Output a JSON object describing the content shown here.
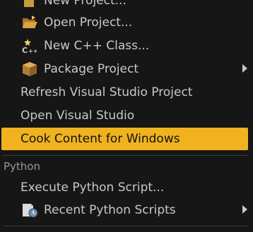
{
  "menu": {
    "items": [
      {
        "label": "New Project...",
        "icon": "new-project-icon"
      },
      {
        "label": "Open Project...",
        "icon": "open-project-icon"
      },
      {
        "label": "New C++ Class...",
        "icon": "new-cpp-class-icon"
      },
      {
        "label": "Package Project",
        "icon": "package-icon",
        "submenu": true
      },
      {
        "label": "Refresh Visual Studio Project"
      },
      {
        "label": "Open Visual Studio"
      },
      {
        "label": "Cook Content for Windows",
        "highlighted": true
      }
    ],
    "python_section": {
      "header": "Python",
      "items": [
        {
          "label": "Execute Python Script..."
        },
        {
          "label": "Recent Python Scripts",
          "icon": "recent-scripts-icon",
          "submenu": true
        }
      ]
    }
  },
  "colors": {
    "background": "#161616",
    "text": "#c8c8c8",
    "highlight": "#f0b21f",
    "section_header": "#9a9a9a"
  }
}
